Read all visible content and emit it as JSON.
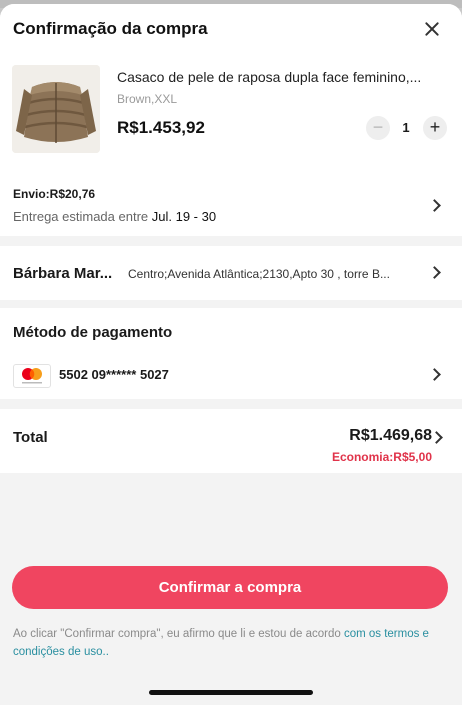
{
  "header": {
    "title": "Confirmação da compra"
  },
  "product": {
    "name": "Casaco de pele de raposa dupla face feminino,...",
    "variant": "Brown,XXL",
    "price": "R$1.453,92",
    "quantity": "1",
    "minus_label": "−",
    "plus_label": "+"
  },
  "shipping": {
    "cost": "Envio:R$20,76",
    "eta_prefix": "Entrega estimada entre ",
    "eta_dates": "Jul. 19 - 30"
  },
  "address": {
    "name": "Bárbara Mar...",
    "line": "Centro;Avenida Atlântica;2130,Apto 30 , torre B..."
  },
  "payment": {
    "title": "Método de pagamento",
    "card_number": "5502 09****** 5027",
    "card_icon": "mastercard-icon"
  },
  "total": {
    "label": "Total",
    "value": "R$1.469,68",
    "savings": "Economia:R$5,00"
  },
  "footer": {
    "confirm_label": "Confirmar a compra",
    "terms_text": "Ao clicar \"Confirmar compra\", eu afirmo que li e estou de acordo ",
    "terms_link": "com os termos e condições de uso.."
  },
  "colors": {
    "accent": "#f04560",
    "savings": "#e0334a",
    "link": "#2a8fa0"
  }
}
